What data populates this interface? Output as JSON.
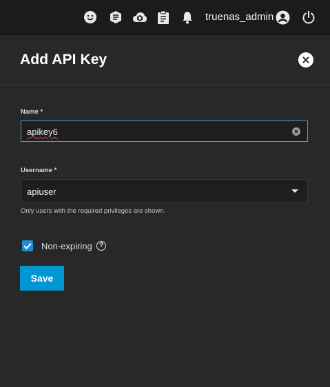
{
  "topbar": {
    "icons": [
      "smiley-feedback-icon",
      "truecommand-icon",
      "truenas-cloud-icon",
      "clipboard-tasks-icon",
      "bell-icon",
      "account-circle-icon",
      "power-icon"
    ],
    "username": "truenas_admin"
  },
  "panel": {
    "title": "Add API Key"
  },
  "form": {
    "name_label": "Name *",
    "name_value": "apikey6",
    "username_label": "Username *",
    "username_value": "apiuser",
    "username_hint": "Only users with the required privileges are shown.",
    "non_expiring_label": "Non-expiring",
    "non_expiring_checked": true,
    "help_glyph": "?",
    "save_label": "Save"
  },
  "colors": {
    "accent": "#0095d5",
    "focus_border": "#3aa0d6",
    "background": "#282828",
    "topbar": "#1b1b1b"
  }
}
